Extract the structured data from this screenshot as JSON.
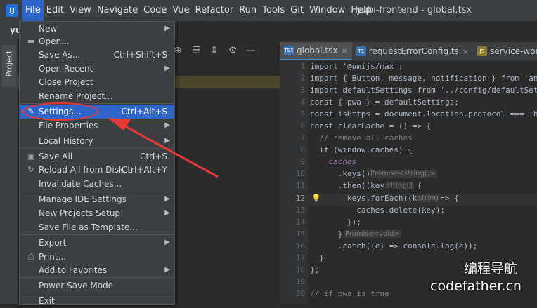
{
  "menubar": {
    "logo": "IJ",
    "items": [
      "File",
      "Edit",
      "View",
      "Navigate",
      "Code",
      "Vue",
      "Refactor",
      "Run",
      "Tools",
      "Git",
      "Window",
      "Help"
    ],
    "window_title": "yubi-frontend - global.tsx"
  },
  "project": {
    "header": "yul",
    "tab_label": "Project"
  },
  "tabs": [
    {
      "label": "global.tsx",
      "icon": "tsx-icon"
    },
    {
      "label": "requestErrorConfig.ts",
      "icon": "ts-icon"
    },
    {
      "label": "service-worker.js",
      "icon": "js-icon"
    }
  ],
  "file_menu": {
    "items": [
      {
        "label": "New",
        "submenu": true,
        "icon": ""
      },
      {
        "label": "Open...",
        "icon": "folder-icon"
      },
      {
        "label": "Save As...",
        "shortcut": "Ctrl+Shift+S"
      },
      {
        "label": "Open Recent",
        "submenu": true
      },
      {
        "label": "Close Project"
      },
      {
        "label": "Rename Project..."
      },
      {
        "label": "Settings...",
        "shortcut": "Ctrl+Alt+S",
        "icon": "wrench-icon"
      },
      {
        "label": "File Properties",
        "submenu": true
      },
      {
        "label": "Local History",
        "submenu": true
      },
      {
        "label": "Save All",
        "shortcut": "Ctrl+S",
        "icon": "save-icon"
      },
      {
        "label": "Reload All from Disk",
        "shortcut": "Ctrl+Alt+Y",
        "icon": "reload-icon"
      },
      {
        "label": "Invalidate Caches..."
      },
      {
        "label": "Manage IDE Settings",
        "submenu": true
      },
      {
        "label": "New Projects Setup",
        "submenu": true
      },
      {
        "label": "Save File as Template..."
      },
      {
        "label": "Export",
        "submenu": true
      },
      {
        "label": "Print...",
        "icon": "print-icon"
      },
      {
        "label": "Add to Favorites",
        "submenu": true
      },
      {
        "label": "Power Save Mode"
      },
      {
        "label": "Exit"
      }
    ]
  },
  "editor": {
    "line_numbers": [
      "1",
      "2",
      "3",
      "4",
      "5",
      "6",
      "7",
      "8",
      "9",
      "10",
      "11",
      "12",
      "13",
      "14",
      "15",
      "16",
      "17",
      "18",
      "19",
      "20"
    ],
    "current_line": "12",
    "code_lines": [
      "import '@umijs/max';",
      "import { Button, message, notification } from 'antd';",
      "import defaultSettings from '../config/defaultSettings';",
      "const { pwa } = defaultSettings;",
      "const isHttps = document.location.protocol === 'https:';",
      "const clearCache = () => {",
      "  // remove all caches",
      "  if (window.caches) {",
      "    caches",
      "      .keys()",
      "      .then((keys ) => {",
      "        keys.forEach((key ) => {",
      "          caches.delete(key);",
      "        });",
      "      })",
      "      .catch((e) => console.log(e));",
      "  }",
      "};",
      "",
      "// if pwa is true"
    ],
    "hints": {
      "promise_strings": "Promise<string[]>",
      "string_arr": "string[]",
      "string": "string",
      "promise_void": "Promise<void>"
    }
  },
  "watermark": {
    "cn": "编程导航",
    "en": "codefather.cn"
  },
  "colors": {
    "accent": "#2f65ca",
    "annotation": "#e53935"
  }
}
